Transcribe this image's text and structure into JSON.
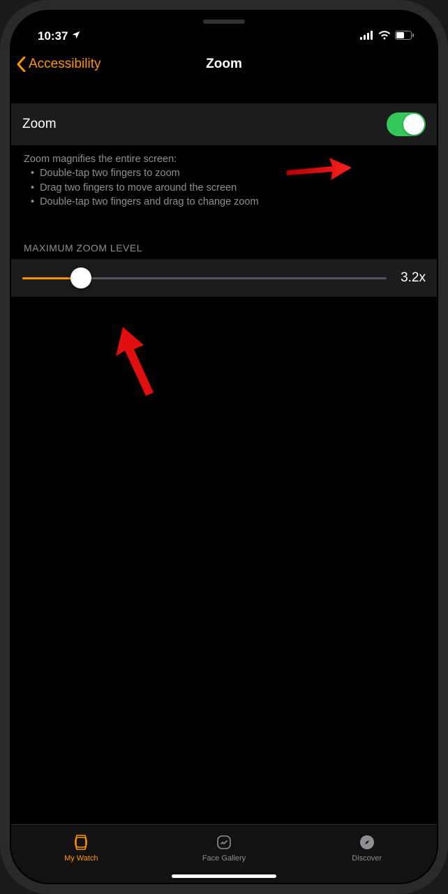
{
  "status_bar": {
    "time": "10:37"
  },
  "nav": {
    "back_label": "Accessibility",
    "title": "Zoom"
  },
  "zoom_toggle": {
    "label": "Zoom",
    "enabled": true
  },
  "zoom_description": {
    "intro": "Zoom magnifies the entire screen:",
    "bullets": [
      "Double-tap two fingers to zoom",
      "Drag two fingers to move around the screen",
      "Double-tap two fingers and drag to change zoom"
    ]
  },
  "max_zoom": {
    "header": "MAXIMUM ZOOM LEVEL",
    "value": "3.2x"
  },
  "tab_bar": {
    "items": [
      {
        "label": "My Watch",
        "active": true
      },
      {
        "label": "Face Gallery",
        "active": false
      },
      {
        "label": "Discover",
        "active": false
      }
    ]
  }
}
